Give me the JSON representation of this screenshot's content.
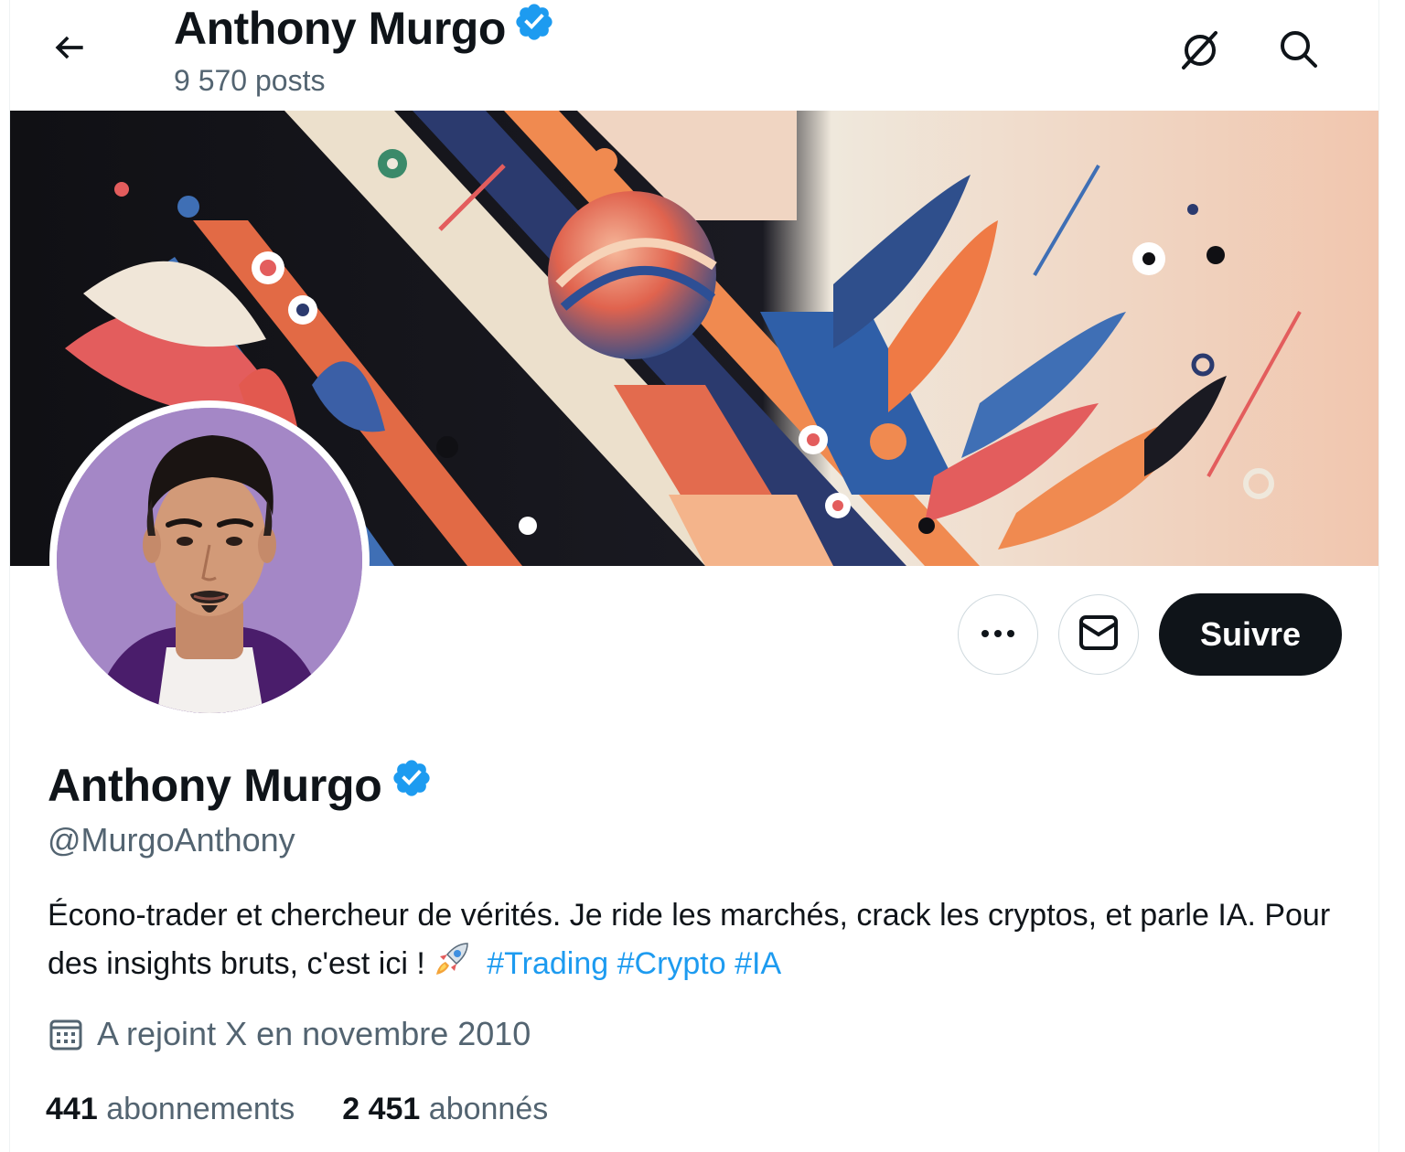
{
  "header": {
    "back_icon": "arrow-left-icon",
    "title": "Anthony Murgo",
    "posts_count": "9 570 posts",
    "grok_icon": "grok-icon",
    "search_icon": "search-icon"
  },
  "colors": {
    "accent": "#1d9bf0",
    "verified_badge": "#1d9bf0",
    "follow_bg": "#0f1419",
    "secondary_text": "#536471",
    "avatar_bg": "#a487c6"
  },
  "actions": {
    "more_icon": "more-horizontal-icon",
    "message_icon": "envelope-icon",
    "follow_label": "Suivre"
  },
  "profile": {
    "name": "Anthony Murgo",
    "handle": "@MurgoAnthony",
    "bio_text": "Écono-trader et chercheur de vérités. Je ride les marchés, crack les cryptos, et parle IA. Pour des insights bruts, c'est ici !",
    "bio_emoji": "rocket-icon",
    "hashtags": [
      "#Trading",
      "#Crypto",
      "#IA"
    ],
    "joined": "A rejoint X en novembre 2010",
    "joined_icon": "calendar-icon"
  },
  "stats": {
    "following_count": "441",
    "following_label": "abonnements",
    "followers_count": "2 451",
    "followers_label": "abonnés"
  }
}
